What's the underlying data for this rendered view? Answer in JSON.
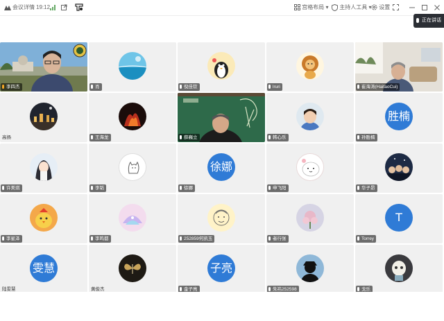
{
  "titlebar": {
    "app_name": "会议详情",
    "time": "19:12",
    "layout_label": "宫格布局",
    "host_tools_label": "主持人工具",
    "settings_label": "设置"
  },
  "speaking_badge": "正在讲话",
  "colors": {
    "avatar_blue": "#2f7bd6",
    "tile_bg": "#f0f0f0",
    "dark_badge": "#2b2e34"
  },
  "participants": [
    {
      "name": "李四杰",
      "avatar": "camera-outdoor"
    },
    {
      "name": "肖",
      "avatar": "ocean-sky"
    },
    {
      "name": "倪佳钦",
      "avatar": "penguin-cartoon"
    },
    {
      "name": "lruri",
      "avatar": "lion-cartoon"
    },
    {
      "name": "崔海涛(HaitaoCui)",
      "avatar": "camera-room"
    },
    {
      "name": "高扬",
      "avatar": "night-city"
    },
    {
      "name": "王海龙",
      "avatar": "red-dark"
    },
    {
      "name": "薛巍立",
      "avatar": "camera-chalkboard"
    },
    {
      "name": "韩心乐",
      "avatar": "child-photo"
    },
    {
      "name": "孙胜楠",
      "avatar_text": "胜楠"
    },
    {
      "name": "许美琪",
      "avatar": "anime-girl"
    },
    {
      "name": "李韬",
      "avatar": "white-dog"
    },
    {
      "name": "徐娜",
      "avatar_text": "徐娜"
    },
    {
      "name": "申飞阳",
      "avatar": "white-bunny"
    },
    {
      "name": "华子昂",
      "avatar": "group-photo"
    },
    {
      "name": "李星泽",
      "avatar": "chick-cartoon"
    },
    {
      "name": "李鸣都",
      "avatar": "pastel-art"
    },
    {
      "name": "252859何凯玉",
      "avatar": "doodle-cartoon"
    },
    {
      "name": "者行张",
      "avatar": "pink-flower"
    },
    {
      "name": "Torrey",
      "avatar_text": "T"
    },
    {
      "name": "陆雯慧",
      "avatar_text": "雯慧"
    },
    {
      "name": "黄俊杰",
      "avatar": "dark-butterfly"
    },
    {
      "name": "金子亮",
      "avatar_text": "子亮"
    },
    {
      "name": "朱祎252598",
      "avatar": "silhouette-photo"
    },
    {
      "name": "戈乐",
      "avatar": "cat-figure"
    }
  ]
}
